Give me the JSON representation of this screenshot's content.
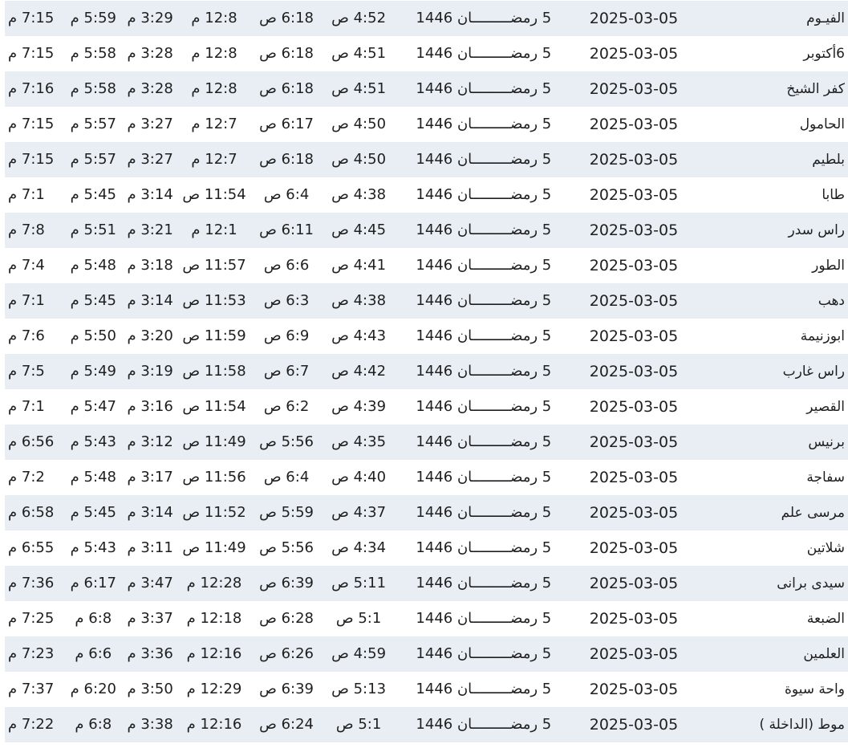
{
  "rows": [
    {
      "city": "الفيـوم",
      "date": "2025-03-05",
      "hijri": "5 رمضـــــــــان 1446",
      "fajr": "4:52 ص",
      "sunrise": "6:18 ص",
      "dhuhr": "12:8 م",
      "asr": "3:29 م",
      "maghrib": "5:59 م",
      "isha": "7:15 م"
    },
    {
      "city": "6أكتوبر",
      "date": "2025-03-05",
      "hijri": "5 رمضـــــــــان 1446",
      "fajr": "4:51 ص",
      "sunrise": "6:18 ص",
      "dhuhr": "12:8 م",
      "asr": "3:28 م",
      "maghrib": "5:58 م",
      "isha": "7:15 م"
    },
    {
      "city": "كفر الشيخ",
      "date": "2025-03-05",
      "hijri": "5 رمضـــــــــان 1446",
      "fajr": "4:51 ص",
      "sunrise": "6:18 ص",
      "dhuhr": "12:8 م",
      "asr": "3:28 م",
      "maghrib": "5:58 م",
      "isha": "7:16 م"
    },
    {
      "city": "الحامول",
      "date": "2025-03-05",
      "hijri": "5 رمضـــــــــان 1446",
      "fajr": "4:50 ص",
      "sunrise": "6:17 ص",
      "dhuhr": "12:7 م",
      "asr": "3:27 م",
      "maghrib": "5:57 م",
      "isha": "7:15 م"
    },
    {
      "city": "بلطيم",
      "date": "2025-03-05",
      "hijri": "5 رمضـــــــــان 1446",
      "fajr": "4:50 ص",
      "sunrise": "6:18 ص",
      "dhuhr": "12:7 م",
      "asr": "3:27 م",
      "maghrib": "5:57 م",
      "isha": "7:15 م"
    },
    {
      "city": "طابا",
      "date": "2025-03-05",
      "hijri": "5 رمضـــــــــان 1446",
      "fajr": "4:38 ص",
      "sunrise": "6:4 ص",
      "dhuhr": "11:54 ص",
      "asr": "3:14 م",
      "maghrib": "5:45 م",
      "isha": "7:1 م"
    },
    {
      "city": "راس سدر",
      "date": "2025-03-05",
      "hijri": "5 رمضـــــــــان 1446",
      "fajr": "4:45 ص",
      "sunrise": "6:11 ص",
      "dhuhr": "12:1 م",
      "asr": "3:21 م",
      "maghrib": "5:51 م",
      "isha": "7:8 م"
    },
    {
      "city": "الطور",
      "date": "2025-03-05",
      "hijri": "5 رمضـــــــــان 1446",
      "fajr": "4:41 ص",
      "sunrise": "6:6 ص",
      "dhuhr": "11:57 ص",
      "asr": "3:18 م",
      "maghrib": "5:48 م",
      "isha": "7:4 م"
    },
    {
      "city": "دهب",
      "date": "2025-03-05",
      "hijri": "5 رمضـــــــــان 1446",
      "fajr": "4:38 ص",
      "sunrise": "6:3 ص",
      "dhuhr": "11:53 ص",
      "asr": "3:14 م",
      "maghrib": "5:45 م",
      "isha": "7:1 م"
    },
    {
      "city": "ابوزنيمة",
      "date": "2025-03-05",
      "hijri": "5 رمضـــــــــان 1446",
      "fajr": "4:43 ص",
      "sunrise": "6:9 ص",
      "dhuhr": "11:59 ص",
      "asr": "3:20 م",
      "maghrib": "5:50 م",
      "isha": "7:6 م"
    },
    {
      "city": "راس غارب",
      "date": "2025-03-05",
      "hijri": "5 رمضـــــــــان 1446",
      "fajr": "4:42 ص",
      "sunrise": "6:7 ص",
      "dhuhr": "11:58 ص",
      "asr": "3:19 م",
      "maghrib": "5:49 م",
      "isha": "7:5 م"
    },
    {
      "city": "القصير",
      "date": "2025-03-05",
      "hijri": "5 رمضـــــــــان 1446",
      "fajr": "4:39 ص",
      "sunrise": "6:2 ص",
      "dhuhr": "11:54 ص",
      "asr": "3:16 م",
      "maghrib": "5:47 م",
      "isha": "7:1 م"
    },
    {
      "city": "برنيس",
      "date": "2025-03-05",
      "hijri": "5 رمضـــــــــان 1446",
      "fajr": "4:35 ص",
      "sunrise": "5:56 ص",
      "dhuhr": "11:49 ص",
      "asr": "3:12 م",
      "maghrib": "5:43 م",
      "isha": "6:56 م"
    },
    {
      "city": "سفاجة",
      "date": "2025-03-05",
      "hijri": "5 رمضـــــــــان 1446",
      "fajr": "4:40 ص",
      "sunrise": "6:4 ص",
      "dhuhr": "11:56 ص",
      "asr": "3:17 م",
      "maghrib": "5:48 م",
      "isha": "7:2 م"
    },
    {
      "city": "مرسى علم",
      "date": "2025-03-05",
      "hijri": "5 رمضـــــــــان 1446",
      "fajr": "4:37 ص",
      "sunrise": "5:59 ص",
      "dhuhr": "11:52 ص",
      "asr": "3:14 م",
      "maghrib": "5:45 م",
      "isha": "6:58 م"
    },
    {
      "city": "شلاتين",
      "date": "2025-03-05",
      "hijri": "5 رمضـــــــــان 1446",
      "fajr": "4:34 ص",
      "sunrise": "5:56 ص",
      "dhuhr": "11:49 ص",
      "asr": "3:11 م",
      "maghrib": "5:43 م",
      "isha": "6:55 م"
    },
    {
      "city": "سيدى برانى",
      "date": "2025-03-05",
      "hijri": "5 رمضـــــــــان 1446",
      "fajr": "5:11 ص",
      "sunrise": "6:39 ص",
      "dhuhr": "12:28 م",
      "asr": "3:47 م",
      "maghrib": "6:17 م",
      "isha": "7:36 م"
    },
    {
      "city": "الضبعة",
      "date": "2025-03-05",
      "hijri": "5 رمضـــــــــان 1446",
      "fajr": "5:1 ص",
      "sunrise": "6:28 ص",
      "dhuhr": "12:18 م",
      "asr": "3:37 م",
      "maghrib": "6:8 م",
      "isha": "7:25 م"
    },
    {
      "city": "العلمين",
      "date": "2025-03-05",
      "hijri": "5 رمضـــــــــان 1446",
      "fajr": "4:59 ص",
      "sunrise": "6:26 ص",
      "dhuhr": "12:16 م",
      "asr": "3:36 م",
      "maghrib": "6:6 م",
      "isha": "7:23 م"
    },
    {
      "city": "واحة سيوة",
      "date": "2025-03-05",
      "hijri": "5 رمضـــــــــان 1446",
      "fajr": "5:13 ص",
      "sunrise": "6:39 ص",
      "dhuhr": "12:29 م",
      "asr": "3:50 م",
      "maghrib": "6:20 م",
      "isha": "7:37 م"
    },
    {
      "city": "موط (الداخلة )",
      "date": "2025-03-05",
      "hijri": "5 رمضـــــــــان 1446",
      "fajr": "5:1 ص",
      "sunrise": "6:24 ص",
      "dhuhr": "12:16 م",
      "asr": "3:38 م",
      "maghrib": "6:8 م",
      "isha": "7:22 م"
    }
  ]
}
